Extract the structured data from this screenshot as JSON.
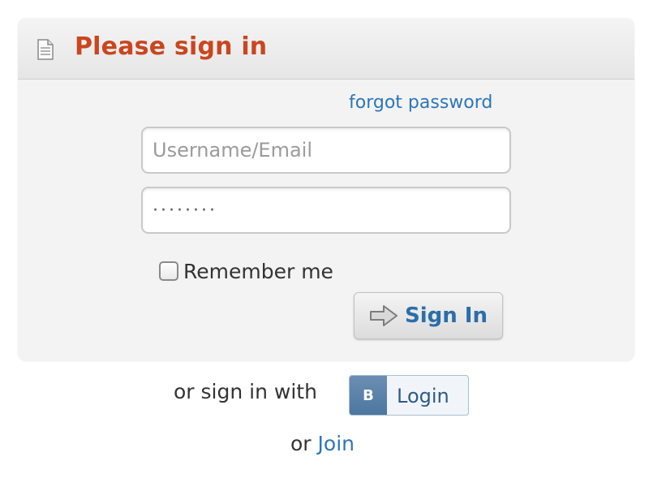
{
  "header": {
    "title": "Please sign in",
    "icon": "document-icon"
  },
  "form": {
    "forgot_link": "forgot password",
    "username_placeholder": "Username/Email",
    "username_value": "",
    "password_value": "········",
    "remember_label": "Remember me",
    "remember_checked": false,
    "signin_label": "Sign In",
    "signin_icon": "arrow-right-icon"
  },
  "alternative": {
    "or_sign_in_with": "or sign in with",
    "vk_badge": "B",
    "vk_label": "Login",
    "or_word": "or",
    "join_link": "Join"
  },
  "colors": {
    "title": "#c9461f",
    "link": "#2d76b8",
    "vk_badge": "#5a80a8"
  }
}
